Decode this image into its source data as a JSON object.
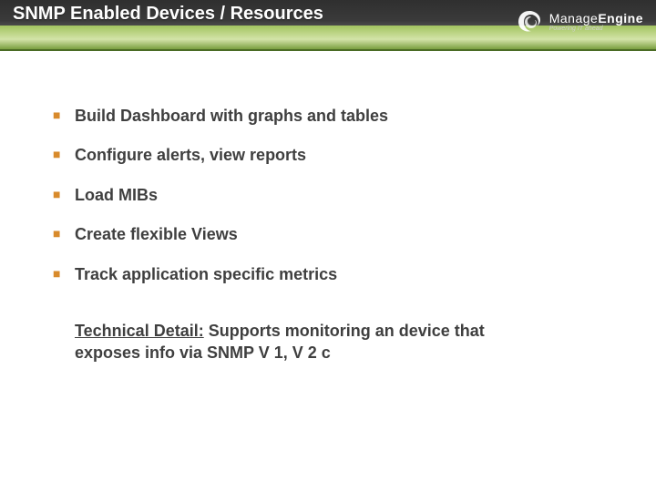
{
  "header": {
    "title": "SNMP Enabled Devices / Resources",
    "logo": {
      "brand_prefix": "Manage",
      "brand_suffix": "Engine",
      "tagline": "Powering IT ahead"
    }
  },
  "bullets": [
    "Build Dashboard with graphs and tables",
    "Configure alerts, view reports",
    "Load MIBs",
    "Create flexible Views",
    "Track application specific metrics"
  ],
  "detail": {
    "lead": "Technical Detail:",
    "body": " Supports monitoring an device that exposes info via SNMP V 1, V 2 c"
  }
}
